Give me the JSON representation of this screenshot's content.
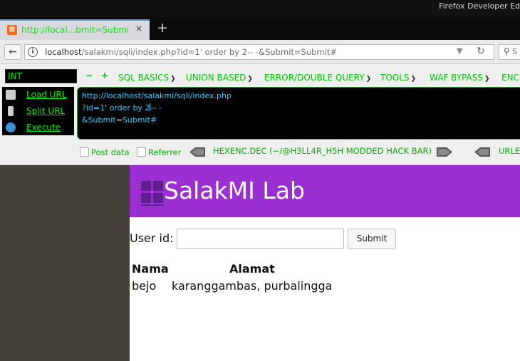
{
  "window": {
    "title": "Firefox Developer Ed"
  },
  "tab": {
    "title": "http://local...bmit=Submit#",
    "close_icon": "×",
    "favicon": "xampp-icon"
  },
  "nav": {
    "back_icon": "back-arrow-icon",
    "url_host": "localhost",
    "url_rest": "/salakmi/sqli/index.php?id=1' order by 2-- -&Submit=Submit#",
    "search_placeholder": "S"
  },
  "hackbar": {
    "encoding": "INT",
    "menus": [
      "SQL BASICS",
      "UNION BASED",
      "ERROR/DOUBLE QUERY",
      "TOOLS",
      "WAF BYPASS",
      "ENCO"
    ],
    "actions": {
      "load_url": "Load URL",
      "split_url": "Split URL",
      "execute": "Execute"
    },
    "query_lines": [
      "http://localhost/salakmi/sqli/index.php",
      "?id=1' order by 2",
      "-- -",
      "&Submit=Submit#"
    ],
    "post_data_label": "Post data",
    "referrer_label": "Referrer",
    "hexenc_label": "HEXENC.DEC (~/@H3LL4R_H5H MODDED HACK BAR)",
    "urle_label": "URLE",
    "accent_color": "#00ee00"
  },
  "lab": {
    "title": "SalakMI Lab",
    "header_color": "#9b2fd2",
    "userid_label": "User id:",
    "userid_value": "",
    "submit_label": "Submit",
    "table": {
      "headers": [
        "Nama",
        "Alamat"
      ],
      "rows": [
        [
          "bejo",
          "karanggambas, purbalingga"
        ]
      ]
    }
  }
}
